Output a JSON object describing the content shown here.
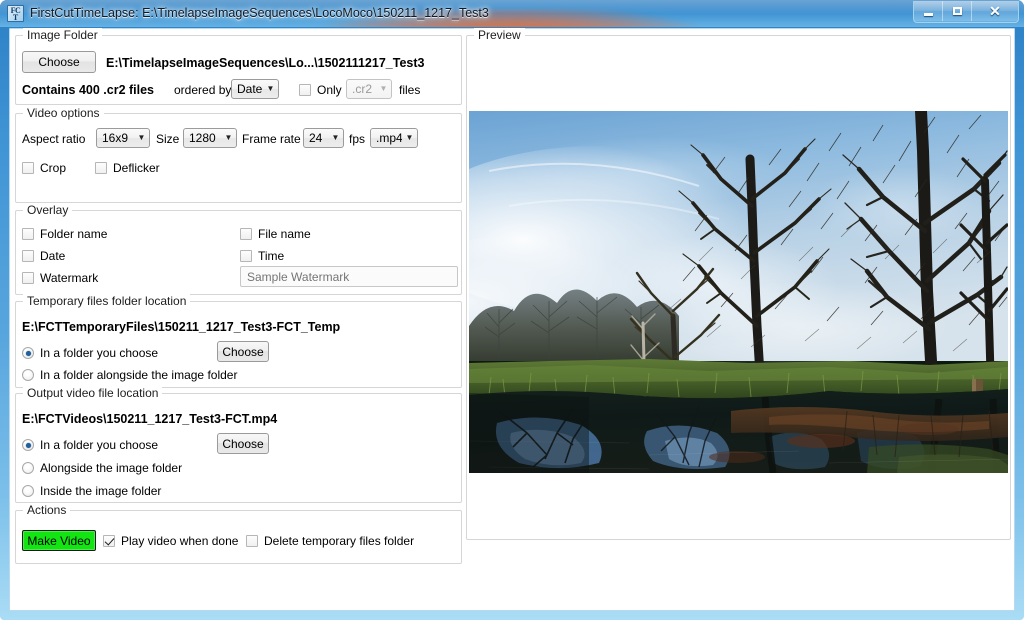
{
  "window": {
    "app_icon_line1": "FC",
    "app_icon_line2": "T",
    "title": "FirstCutTimeLapse: E:\\TimelapseImageSequences\\LocoMoco\\150211_1217_Test3",
    "minimize_label": "Minimize",
    "maximize_label": "Maximize",
    "close_label": "✕",
    "accent_color": "#3b8fd0",
    "glow_color": "#f8601a"
  },
  "image_folder": {
    "legend": "Image Folder",
    "choose_label": "Choose",
    "path": "E:\\TimelapseImageSequences\\Lo...\\1502111217_Test3",
    "contains_text": "Contains 400 .cr2 files",
    "ordered_by_label": "ordered by",
    "order_value": "Date",
    "only_label": "Only",
    "only_checked": false,
    "extension_value": ".cr2",
    "files_label": "files"
  },
  "video_options": {
    "legend": "Video options",
    "aspect_ratio_label": "Aspect ratio",
    "aspect_ratio_value": "16x9",
    "size_label": "Size",
    "size_value": "1280",
    "frame_rate_label": "Frame rate",
    "frame_rate_value": "24",
    "fps_label": "fps",
    "format_value": ".mp4",
    "crop_label": "Crop",
    "crop_checked": false,
    "deflicker_label": "Deflicker",
    "deflicker_checked": false
  },
  "overlay": {
    "legend": "Overlay",
    "folder_name_label": "Folder name",
    "folder_name_checked": false,
    "file_name_label": "File name",
    "file_name_checked": false,
    "date_label": "Date",
    "date_checked": false,
    "time_label": "Time",
    "time_checked": false,
    "watermark_label": "Watermark",
    "watermark_checked": false,
    "watermark_placeholder": "Sample Watermark",
    "watermark_value": ""
  },
  "temp_files": {
    "legend": "Temporary files folder location",
    "path": "E:\\FCTTemporaryFiles\\150211_1217_Test3-FCT_Temp",
    "option_choose_label": "In a folder you choose",
    "option_alongside_label": "In a folder alongside the image folder",
    "selected_option": "choose",
    "choose_button_label": "Choose"
  },
  "output_video": {
    "legend": "Output video file location",
    "path": "E:\\FCTVideos\\150211_1217_Test3-FCT.mp4",
    "option_choose_label": "In a folder you choose",
    "option_alongside_label": "Alongside the image folder",
    "option_inside_label": "Inside the image folder",
    "selected_option": "choose",
    "choose_button_label": "Choose"
  },
  "actions": {
    "legend": "Actions",
    "make_video_label": "Make Video",
    "make_video_color": "#12e512",
    "play_when_done_label": "Play video when done",
    "play_when_done_checked": true,
    "delete_temp_label": "Delete temporary files folder",
    "delete_temp_checked": false
  },
  "preview": {
    "legend": "Preview",
    "image_description": "Timelapse frame: bare winter trees reflected in a still pond with blue sky and scattered clouds"
  }
}
